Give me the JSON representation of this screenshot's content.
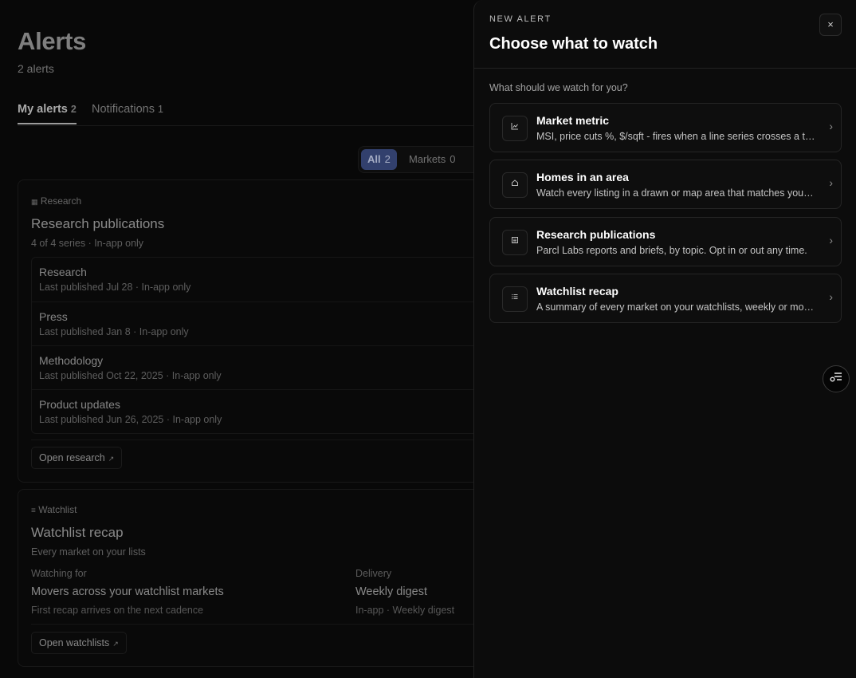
{
  "page": {
    "title": "Alerts",
    "subtitle": "2 alerts"
  },
  "tabs": [
    {
      "label": "My alerts",
      "count": "2",
      "active": true
    },
    {
      "label": "Notifications",
      "count": "1",
      "active": false
    }
  ],
  "filter": {
    "all_label": "All",
    "all_count": "2",
    "markets_label": "Markets",
    "markets_count": "0"
  },
  "research_card": {
    "kicker": "Research",
    "kicker_icon": "newspaper-icon",
    "title": "Research publications",
    "meta": "4 of 4 series · In-app only",
    "series": [
      {
        "name": "Research",
        "meta": "Last published Jul 28 · In-app only"
      },
      {
        "name": "Press",
        "meta": "Last published Jan 8 · In-app only"
      },
      {
        "name": "Methodology",
        "meta": "Last published Oct 22, 2025 · In-app only"
      },
      {
        "name": "Product updates",
        "meta": "Last published Jun 26, 2025 · In-app only"
      }
    ],
    "button": "Open research"
  },
  "watchlist_card": {
    "kicker": "Watchlist",
    "kicker_icon": "list-icon",
    "title": "Watchlist recap",
    "meta": "Every market on your lists",
    "watching_label": "Watching for",
    "watching_value": "Movers across your watchlist markets",
    "watching_sub": "First recap arrives on the next cadence",
    "delivery_label": "Delivery",
    "delivery_value": "Weekly digest",
    "delivery_sub": "In-app · Weekly digest",
    "button": "Open watchlists"
  },
  "panel": {
    "kicker": "NEW ALERT",
    "title": "Choose what to watch",
    "close": "×",
    "prompt": "What should we watch for you?",
    "options": [
      {
        "title": "Market metric",
        "desc": "MSI, price cuts %, $/sqft - fires when a line series crosses a threshold you set.",
        "icon": "chart-icon"
      },
      {
        "title": "Homes in an area",
        "desc": "Watch every listing in a drawn or map area that matches your filters.",
        "icon": "home-icon"
      },
      {
        "title": "Research publications",
        "desc": "Parcl Labs reports and briefs, by topic. Opt in or out any time.",
        "icon": "newspaper-icon"
      },
      {
        "title": "Watchlist recap",
        "desc": "A summary of every market on your watchlists, weekly or monthly.",
        "icon": "list-icon"
      }
    ]
  },
  "colors": {
    "accent": "#3e4f86",
    "background": "#0a0a0a"
  }
}
